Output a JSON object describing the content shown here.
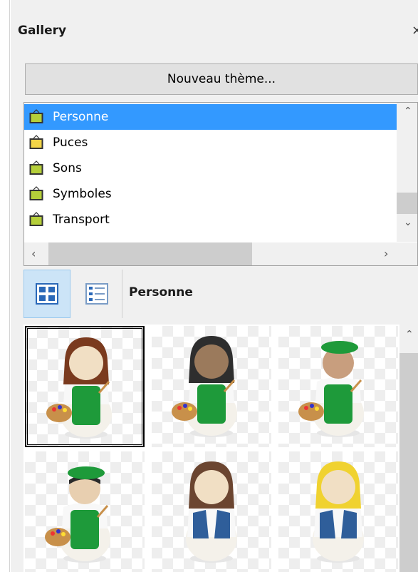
{
  "panel": {
    "title": "Gallery",
    "close_glyph": "×"
  },
  "toolbar": {
    "new_theme_label": "Nouveau thème..."
  },
  "themes": {
    "items": [
      {
        "label": "Personne",
        "selected": true
      },
      {
        "label": "Puces",
        "selected": false
      },
      {
        "label": "Sons",
        "selected": false
      },
      {
        "label": "Symboles",
        "selected": false
      },
      {
        "label": "Transport",
        "selected": false
      }
    ]
  },
  "view": {
    "icon_view_icon": "grid-view-icon",
    "detail_view_icon": "list-view-icon",
    "current_theme": "Personne"
  },
  "gallery": {
    "items": [
      {
        "icon": "painter-woman-brown-hair-icon",
        "selected": true
      },
      {
        "icon": "painter-woman-black-hair-icon",
        "selected": false
      },
      {
        "icon": "painter-man-beret-icon",
        "selected": false
      },
      {
        "icon": "painter-man-beret-dark-icon",
        "selected": false
      },
      {
        "icon": "woman-brown-hair-vest-icon",
        "selected": false
      },
      {
        "icon": "woman-blonde-hair-vest-icon",
        "selected": false
      }
    ]
  },
  "colors": {
    "selection": "#3399ff",
    "apron_green": "#1e9a3a",
    "vest_blue": "#2f5e9a"
  }
}
